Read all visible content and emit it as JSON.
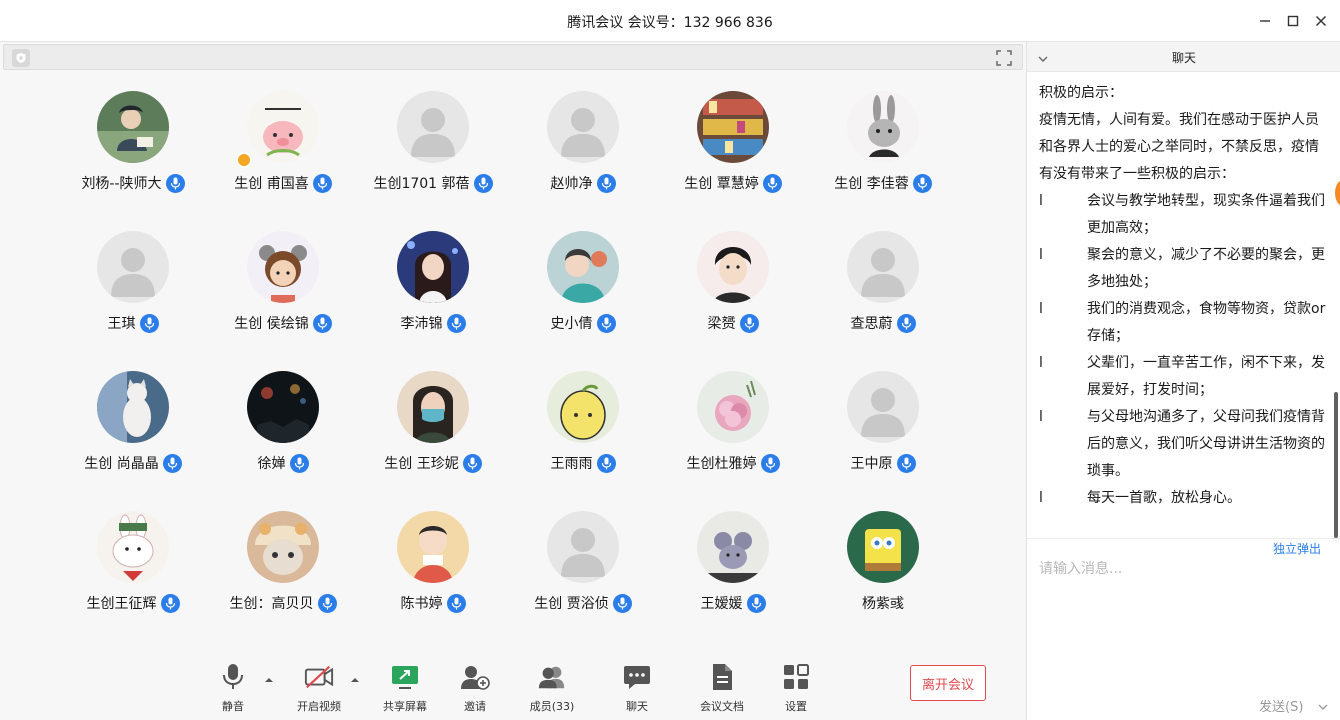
{
  "window": {
    "title": "腾讯会议 会议号：132 966 836"
  },
  "participants": [
    {
      "name": "刘杨--陕师大",
      "avatar": "photo-boy",
      "host": false
    },
    {
      "name": "生创 甫国喜",
      "avatar": "pig-cartoon",
      "host": true
    },
    {
      "name": "生创1701  郭蓓",
      "avatar": "default",
      "host": false
    },
    {
      "name": "赵帅净",
      "avatar": "default",
      "host": false
    },
    {
      "name": "生创 覃慧婷",
      "avatar": "shelves",
      "host": false
    },
    {
      "name": "生创 李佳蓉",
      "avatar": "rabbit-sketch",
      "host": false
    },
    {
      "name": "王琪",
      "avatar": "default",
      "host": false
    },
    {
      "name": "生创 侯绘锦",
      "avatar": "girl-cartoon",
      "host": false
    },
    {
      "name": "李沛锦",
      "avatar": "photo-girl",
      "host": false
    },
    {
      "name": "史小倩",
      "avatar": "photo-teal",
      "host": false
    },
    {
      "name": "梁赟",
      "avatar": "prince",
      "host": false
    },
    {
      "name": "查思蔚",
      "avatar": "default",
      "host": false
    },
    {
      "name": "生创 尚晶晶",
      "avatar": "cat-photo",
      "host": false
    },
    {
      "name": "徐婵",
      "avatar": "night",
      "host": false
    },
    {
      "name": "生创 王珍妮",
      "avatar": "mask-girl",
      "host": false
    },
    {
      "name": "王雨雨",
      "avatar": "pear",
      "host": false
    },
    {
      "name": "生创杜雅婷",
      "avatar": "flower",
      "host": false
    },
    {
      "name": "王中原",
      "avatar": "default",
      "host": false
    },
    {
      "name": "生创王征辉",
      "avatar": "rabbit-cartoon",
      "host": false
    },
    {
      "name": "生创：高贝贝",
      "avatar": "cat-hat",
      "host": false
    },
    {
      "name": "陈书婷",
      "avatar": "kid-cartoon",
      "host": false
    },
    {
      "name": "生创  贾浴侦",
      "avatar": "default",
      "host": false
    },
    {
      "name": "王嫒媛",
      "avatar": "mouse",
      "host": false
    },
    {
      "name": "杨紫彧",
      "avatar": "spongebob",
      "host": false,
      "mic": false
    }
  ],
  "toolbar": {
    "mute": "静音",
    "video": "开启视频",
    "share": "共享屏幕",
    "invite": "邀请",
    "members": "成员(33)",
    "chat": "聊天",
    "docs": "会议文档",
    "settings": "设置",
    "leave": "离开会议"
  },
  "chat": {
    "title": "聊天",
    "heading": "积极的启示：",
    "intro": "疫情无情，人间有爱。我们在感动于医护人员和各界人士的爱心之举同时，不禁反思，疫情有没有带来了一些积极的启示：",
    "bullet_mark": "l",
    "items": [
      "会议与教学地转型，现实条件逼着我们更加高效；",
      "聚会的意义，减少了不必要的聚会，更多地独处；",
      "我们的消费观念，食物等物资，贷款or存储；",
      "父辈们，一直辛苦工作，闲不下来，发展爱好，打发时间；",
      "与父母地沟通多了，父母问我们疫情背后的意义，我们听父母讲讲生活物资的琐事。",
      "每天一首歌，放松身心。"
    ],
    "popout": "独立弹出",
    "placeholder": "请输入消息...",
    "send": "发送(S)"
  }
}
